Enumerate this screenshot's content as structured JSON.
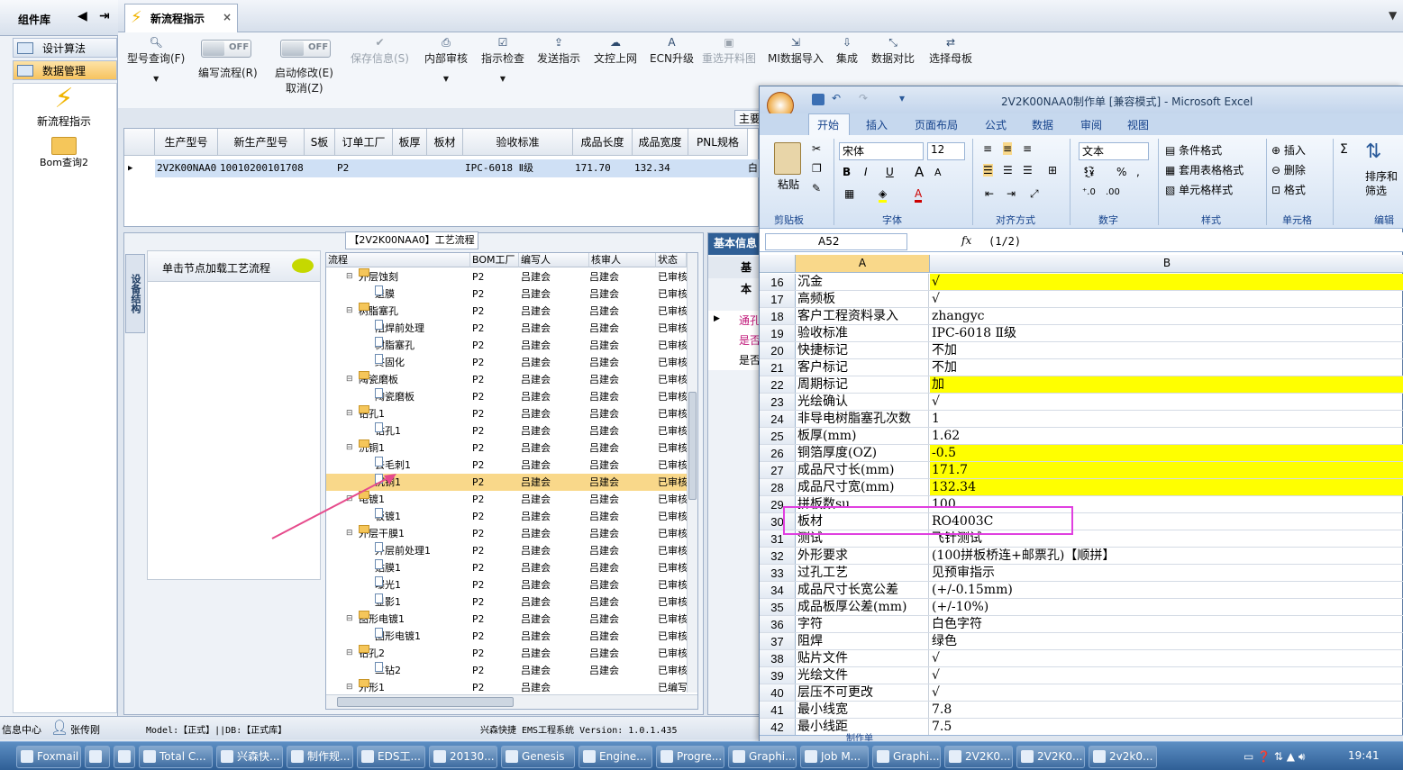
{
  "left_panel": {
    "title": "组件库",
    "items": [
      {
        "label": "设计算法"
      },
      {
        "label": "数据管理"
      }
    ],
    "big_items": [
      {
        "label": "新流程指示"
      },
      {
        "label": "Bom查询2"
      }
    ]
  },
  "tab": {
    "label": "新流程指示",
    "close": "×"
  },
  "toolbar": {
    "model_query": "型号查询(F)",
    "edit_flow": "编写流程(R)",
    "toggle_off": "OFF",
    "start_modify": "启动修改(E)",
    "cancel": "取消(Z)",
    "save": "保存信息(S)",
    "internal_review": "内部审核",
    "check": "指示检查",
    "send": "发送指示",
    "upload": "文控上网",
    "ecn": "ECN升级",
    "reselect": "重选开料图",
    "mi_import": "MI数据导入",
    "integrate": "集成",
    "compare": "数据对比",
    "mother_board": "选择母板"
  },
  "grid": {
    "partial_tab": "主要",
    "headers": [
      "生产型号",
      "新生产型号",
      "S板",
      "订单工厂",
      "板厚",
      "板材",
      "验收标准",
      "成品长度",
      "成品宽度",
      "PNL规格"
    ],
    "row": [
      "2V2K00NAA0",
      "10010200101708",
      "",
      "P2",
      "",
      "",
      "IPC-6018 Ⅱ级",
      "171.70",
      "132.34",
      "",
      "白"
    ]
  },
  "process": {
    "title": "【2V2K00NAA0】工艺流程",
    "side_tab": "设备结构",
    "click_hint": "单击节点加载工艺流程",
    "headers": [
      "流程",
      "BOM工厂",
      "编写人",
      "核审人",
      "状态"
    ],
    "rows": [
      {
        "level": 0,
        "name": "外层蚀刻",
        "bom": "P2",
        "writer": "吕建会",
        "reviewer": "吕建会",
        "status": "已审核"
      },
      {
        "level": 1,
        "name": "退膜",
        "bom": "P2",
        "writer": "吕建会",
        "reviewer": "吕建会",
        "status": "已审核"
      },
      {
        "level": 0,
        "name": "树脂塞孔",
        "bom": "P2",
        "writer": "吕建会",
        "reviewer": "吕建会",
        "status": "已审核"
      },
      {
        "level": 1,
        "name": "阻焊前处理",
        "bom": "P2",
        "writer": "吕建会",
        "reviewer": "吕建会",
        "status": "已审核"
      },
      {
        "level": 1,
        "name": "树脂塞孔",
        "bom": "P2",
        "writer": "吕建会",
        "reviewer": "吕建会",
        "status": "已审核"
      },
      {
        "level": 1,
        "name": "终固化",
        "bom": "P2",
        "writer": "吕建会",
        "reviewer": "吕建会",
        "status": "已审核"
      },
      {
        "level": 0,
        "name": "陶瓷磨板",
        "bom": "P2",
        "writer": "吕建会",
        "reviewer": "吕建会",
        "status": "已审核"
      },
      {
        "level": 1,
        "name": "陶瓷磨板",
        "bom": "P2",
        "writer": "吕建会",
        "reviewer": "吕建会",
        "status": "已审核"
      },
      {
        "level": 0,
        "name": "钻孔1",
        "bom": "P2",
        "writer": "吕建会",
        "reviewer": "吕建会",
        "status": "已审核"
      },
      {
        "level": 1,
        "name": "钻孔1",
        "bom": "P2",
        "writer": "吕建会",
        "reviewer": "吕建会",
        "status": "已审核"
      },
      {
        "level": 0,
        "name": "沉铜1",
        "bom": "P2",
        "writer": "吕建会",
        "reviewer": "吕建会",
        "status": "已审核"
      },
      {
        "level": 1,
        "name": "去毛刺1",
        "bom": "P2",
        "writer": "吕建会",
        "reviewer": "吕建会",
        "status": "已审核"
      },
      {
        "level": 1,
        "name": "沉铜1",
        "bom": "P2",
        "writer": "吕建会",
        "reviewer": "吕建会",
        "status": "已审核",
        "selected": true
      },
      {
        "level": 0,
        "name": "电镀1",
        "bom": "P2",
        "writer": "吕建会",
        "reviewer": "吕建会",
        "status": "已审核"
      },
      {
        "level": 1,
        "name": "板镀1",
        "bom": "P2",
        "writer": "吕建会",
        "reviewer": "吕建会",
        "status": "已审核"
      },
      {
        "level": 0,
        "name": "外层干膜1",
        "bom": "P2",
        "writer": "吕建会",
        "reviewer": "吕建会",
        "status": "已审核"
      },
      {
        "level": 1,
        "name": "外层前处理1",
        "bom": "P2",
        "writer": "吕建会",
        "reviewer": "吕建会",
        "status": "已审核"
      },
      {
        "level": 1,
        "name": "贴膜1",
        "bom": "P2",
        "writer": "吕建会",
        "reviewer": "吕建会",
        "status": "已审核"
      },
      {
        "level": 1,
        "name": "曝光1",
        "bom": "P2",
        "writer": "吕建会",
        "reviewer": "吕建会",
        "status": "已审核"
      },
      {
        "level": 1,
        "name": "显影1",
        "bom": "P2",
        "writer": "吕建会",
        "reviewer": "吕建会",
        "status": "已审核"
      },
      {
        "level": 0,
        "name": "图形电镀1",
        "bom": "P2",
        "writer": "吕建会",
        "reviewer": "吕建会",
        "status": "已审核"
      },
      {
        "level": 1,
        "name": "图形电镀1",
        "bom": "P2",
        "writer": "吕建会",
        "reviewer": "吕建会",
        "status": "已审核"
      },
      {
        "level": 0,
        "name": "钻孔2",
        "bom": "P2",
        "writer": "吕建会",
        "reviewer": "吕建会",
        "status": "已审核"
      },
      {
        "level": 1,
        "name": "二钻2",
        "bom": "P2",
        "writer": "吕建会",
        "reviewer": "吕建会",
        "status": "已审核"
      },
      {
        "level": 0,
        "name": "外形1",
        "bom": "P2",
        "writer": "吕建会",
        "reviewer": "",
        "status": "已编写"
      }
    ]
  },
  "basic": {
    "title": "基本信息",
    "sub": "基本",
    "rows": [
      "通孔",
      "是否",
      "是否"
    ]
  },
  "status_bar": {
    "center": "信息中心",
    "user": "张传刚",
    "model": "Model:【正式】||DB:【正式库】",
    "system": "兴森快捷 EMS工程系统 Version: 1.0.1.435"
  },
  "excel": {
    "title": "2V2K00NAA0制作单 [兼容模式] - Microsoft Excel",
    "tabs": [
      "开始",
      "插入",
      "页面布局",
      "公式",
      "数据",
      "审阅",
      "视图"
    ],
    "clipboard": {
      "paste": "粘贴",
      "label": "剪贴板"
    },
    "font": {
      "name": "宋体",
      "size": "12",
      "label": "字体"
    },
    "align_label": "对齐方式",
    "number": {
      "format": "文本",
      "label": "数字"
    },
    "styles": {
      "cond": "条件格式",
      "table": "套用表格格式",
      "cell": "单元格样式",
      "label": "样式"
    },
    "cells": {
      "insert": "插入",
      "delete": "删除",
      "format": "格式",
      "label": "单元格"
    },
    "edit": {
      "sort": "排序和筛选",
      "label": "编辑"
    },
    "name_box": "A52",
    "fx": "fx",
    "formula": "(1/2)",
    "col_a": "A",
    "col_b": "B",
    "sheet_tab": "制作单",
    "rows": [
      {
        "n": "16",
        "a": "沉金",
        "b": "√",
        "y": true
      },
      {
        "n": "17",
        "a": "高频板",
        "b": "√",
        "y": false
      },
      {
        "n": "18",
        "a": "客户工程资料录入",
        "b": "zhangyc",
        "y": false
      },
      {
        "n": "19",
        "a": "验收标准",
        "b": "IPC-6018 Ⅱ级",
        "y": false
      },
      {
        "n": "20",
        "a": "快捷标记",
        "b": "不加",
        "y": false
      },
      {
        "n": "21",
        "a": "客户标记",
        "b": "不加",
        "y": false
      },
      {
        "n": "22",
        "a": "周期标记",
        "b": "加",
        "y": true
      },
      {
        "n": "23",
        "a": "光绘确认",
        "b": "√",
        "y": false
      },
      {
        "n": "24",
        "a": "非导电树脂塞孔次数",
        "b": "1",
        "y": false
      },
      {
        "n": "25",
        "a": "板厚(mm)",
        "b": "1.62",
        "y": false
      },
      {
        "n": "26",
        "a": "铜箔厚度(OZ)",
        "b": "-0.5",
        "y": true
      },
      {
        "n": "27",
        "a": "成品尺寸长(mm)",
        "b": "171.7",
        "y": true
      },
      {
        "n": "28",
        "a": "成品尺寸宽(mm)",
        "b": "132.34",
        "y": true
      },
      {
        "n": "29",
        "a": "拼板数su",
        "b": "100",
        "y": false
      },
      {
        "n": "30",
        "a": "板材",
        "b": "RO4003C",
        "y": false
      },
      {
        "n": "31",
        "a": "测试",
        "b": "飞针测试",
        "y": false
      },
      {
        "n": "32",
        "a": "外形要求",
        "b": "(100拼板桥连+邮票孔)【顺拼】",
        "y": false
      },
      {
        "n": "33",
        "a": "过孔工艺",
        "b": "见预审指示",
        "y": false
      },
      {
        "n": "34",
        "a": "成品尺寸长宽公差",
        "b": "(+/-0.15mm)",
        "y": false
      },
      {
        "n": "35",
        "a": "成品板厚公差(mm)",
        "b": "(+/-10%)",
        "y": false
      },
      {
        "n": "36",
        "a": "字符",
        "b": "白色字符",
        "y": false
      },
      {
        "n": "37",
        "a": "阻焊",
        "b": "绿色",
        "y": false
      },
      {
        "n": "38",
        "a": "贴片文件",
        "b": "√",
        "y": false
      },
      {
        "n": "39",
        "a": "光绘文件",
        "b": "√",
        "y": false
      },
      {
        "n": "40",
        "a": "层压不可更改",
        "b": "√",
        "y": false
      },
      {
        "n": "41",
        "a": "最小线宽",
        "b": "7.8",
        "y": false
      },
      {
        "n": "42",
        "a": "最小线距",
        "b": "7.5",
        "y": false
      }
    ]
  },
  "taskbar": {
    "items": [
      "Foxmail",
      "",
      "",
      "Total C...",
      "兴森快...",
      "制作规...",
      "EDS工...",
      "20130...",
      "Genesis",
      "Engine...",
      "Progre...",
      "Graphi...",
      "Job M...",
      "Graphi...",
      "2V2K0...",
      "2V2K0...",
      "2v2k0..."
    ],
    "clock": "19:41"
  },
  "colors": {
    "accent": "#2f5f96",
    "highlight": "#ffff00",
    "selected_row": "#f9d88a",
    "annotation": "#e64b8c"
  }
}
